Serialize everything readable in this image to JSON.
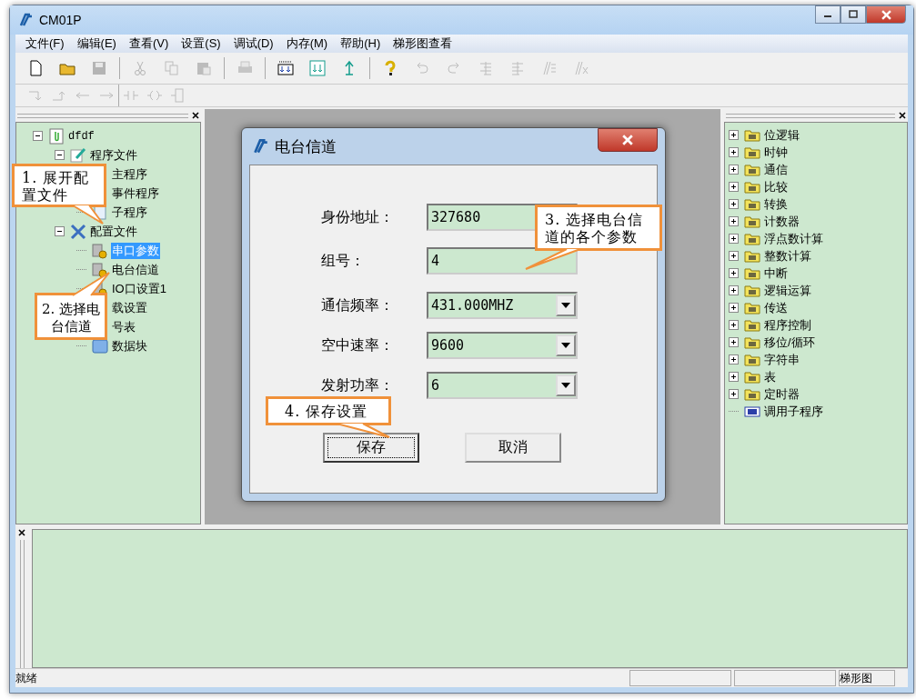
{
  "window": {
    "title": "CM01P"
  },
  "menu": [
    "文件(F)",
    "编辑(E)",
    "查看(V)",
    "设置(S)",
    "调试(D)",
    "内存(M)",
    "帮助(H)",
    "梯形图查看"
  ],
  "toolbars": [
    {
      "groups": [
        [
          {
            "kind": "new",
            "disabled": false
          },
          {
            "kind": "open",
            "disabled": false
          },
          {
            "kind": "save",
            "disabled": true
          }
        ],
        [
          {
            "kind": "cut",
            "disabled": true
          },
          {
            "kind": "copy",
            "disabled": true
          },
          {
            "kind": "paste",
            "disabled": true
          }
        ],
        [
          {
            "kind": "print",
            "disabled": true
          }
        ],
        [
          {
            "kind": "download-all",
            "disabled": false
          },
          {
            "kind": "download",
            "disabled": false
          },
          {
            "kind": "upload",
            "disabled": false
          }
        ],
        [
          {
            "kind": "help",
            "disabled": false
          },
          {
            "kind": "undo",
            "disabled": true
          },
          {
            "kind": "redo",
            "disabled": true
          },
          {
            "kind": "indent",
            "disabled": true
          },
          {
            "kind": "outdent",
            "disabled": true
          },
          {
            "kind": "comment",
            "disabled": true
          },
          {
            "kind": "uncomment",
            "disabled": true
          }
        ]
      ]
    },
    {
      "groups": [
        [
          {
            "kind": "branch-down",
            "disabled": true
          },
          {
            "kind": "branch-up",
            "disabled": true
          },
          {
            "kind": "left",
            "disabled": true
          },
          {
            "kind": "right",
            "disabled": true
          }
        ],
        [
          {
            "kind": "contact",
            "disabled": true
          },
          {
            "kind": "coil",
            "disabled": true
          },
          {
            "kind": "block",
            "disabled": true
          }
        ]
      ]
    }
  ],
  "project_tree": {
    "items": [
      {
        "label": "dfdf",
        "expanded": true,
        "selected": false,
        "children": [
          {
            "label": "程序文件",
            "expanded": true,
            "selected": false,
            "children": [
              {
                "label": "主程序",
                "selected": false
              },
              {
                "label": "事件程序",
                "selected": false
              },
              {
                "label": "子程序",
                "selected": false
              }
            ]
          },
          {
            "label": "配置文件",
            "expanded": true,
            "selected": false,
            "children": [
              {
                "label": "串口参数",
                "selected": true
              },
              {
                "label": "电台信道",
                "selected": false
              },
              {
                "label": "IO口设置1",
                "selected": false
              },
              {
                "label": "载设置",
                "selected": false
              },
              {
                "label": "号表",
                "selected": false
              },
              {
                "label": "数据块",
                "selected": false
              }
            ]
          }
        ]
      }
    ]
  },
  "instruction_tree": {
    "items": [
      {
        "label": "位逻辑",
        "expandable": true
      },
      {
        "label": "时钟",
        "expandable": true
      },
      {
        "label": "通信",
        "expandable": true
      },
      {
        "label": "比较",
        "expandable": true
      },
      {
        "label": "转换",
        "expandable": true
      },
      {
        "label": "计数器",
        "expandable": true
      },
      {
        "label": "浮点数计算",
        "expandable": true
      },
      {
        "label": "整数计算",
        "expandable": true
      },
      {
        "label": "中断",
        "expandable": true
      },
      {
        "label": "逻辑运算",
        "expandable": true
      },
      {
        "label": "传送",
        "expandable": true
      },
      {
        "label": "程序控制",
        "expandable": true
      },
      {
        "label": "移位/循环",
        "expandable": true
      },
      {
        "label": "字符串",
        "expandable": true
      },
      {
        "label": "表",
        "expandable": true
      },
      {
        "label": "定时器",
        "expandable": true
      },
      {
        "label": "调用子程序",
        "expandable": false
      }
    ]
  },
  "dialog": {
    "title": "电台信道",
    "fields": [
      {
        "label": "身份地址：",
        "kind": "text",
        "value": "327680"
      },
      {
        "label": "组号：",
        "kind": "text",
        "value": "4"
      },
      {
        "label": "通信频率：",
        "kind": "select",
        "value": "431.000MHZ"
      },
      {
        "label": "空中速率：",
        "kind": "select",
        "value": "9600"
      },
      {
        "label": "发射功率：",
        "kind": "select",
        "value": "6"
      }
    ],
    "buttons": [
      {
        "label": "保存",
        "focused": true
      },
      {
        "label": "取消",
        "focused": false
      }
    ]
  },
  "callouts": [
    "1. 展开配置文件",
    "2. 选择电台信道",
    "3. 选择电台信道的各个参数",
    "4. 保存设置"
  ],
  "status_bar": {
    "text": "就绪",
    "mode": "梯形图"
  }
}
